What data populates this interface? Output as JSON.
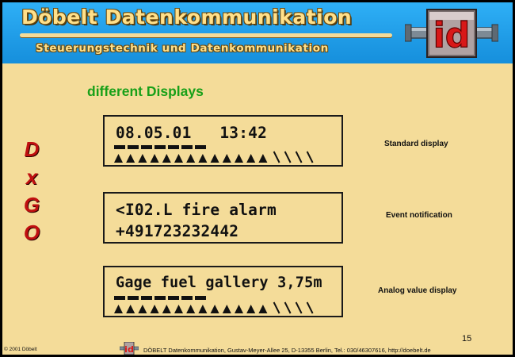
{
  "header": {
    "title": "Döbelt Datenkommunikation",
    "subtitle": "Steuerungstechnik und Datenkommunikation",
    "logo_text": "id"
  },
  "section_heading": "different Displays",
  "side_letters": [
    "D",
    "x",
    "G",
    "O"
  ],
  "displays": [
    {
      "line1": "08.05.01   13:42",
      "line2": "",
      "caption": "Standard display",
      "has_bars": true,
      "dashes": 7,
      "triangles": 13,
      "slashes": 4
    },
    {
      "line1": "<I02.L fire alarm",
      "line2": "+491723232442",
      "caption": "Event notification",
      "has_bars": false
    },
    {
      "line1": "Gage fuel gallery 3,75m",
      "line2": "",
      "caption": "Analog value display",
      "has_bars": true,
      "dashes": 7,
      "triangles": 13,
      "slashes": 4
    }
  ],
  "page_number": "15",
  "footer": {
    "copyright": "© 2001 Döbelt",
    "address": "DÖBELT Datenkommunikation, Gustav-Meyer-Allee 25, D-13355 Berlin, Tel.: 030/46307616, http://doebelt.de"
  },
  "colors": {
    "header_blue": "#1f9be6",
    "slide_background": "#f4dc99",
    "heading_green": "#18a018",
    "letter_red": "#c01010"
  }
}
